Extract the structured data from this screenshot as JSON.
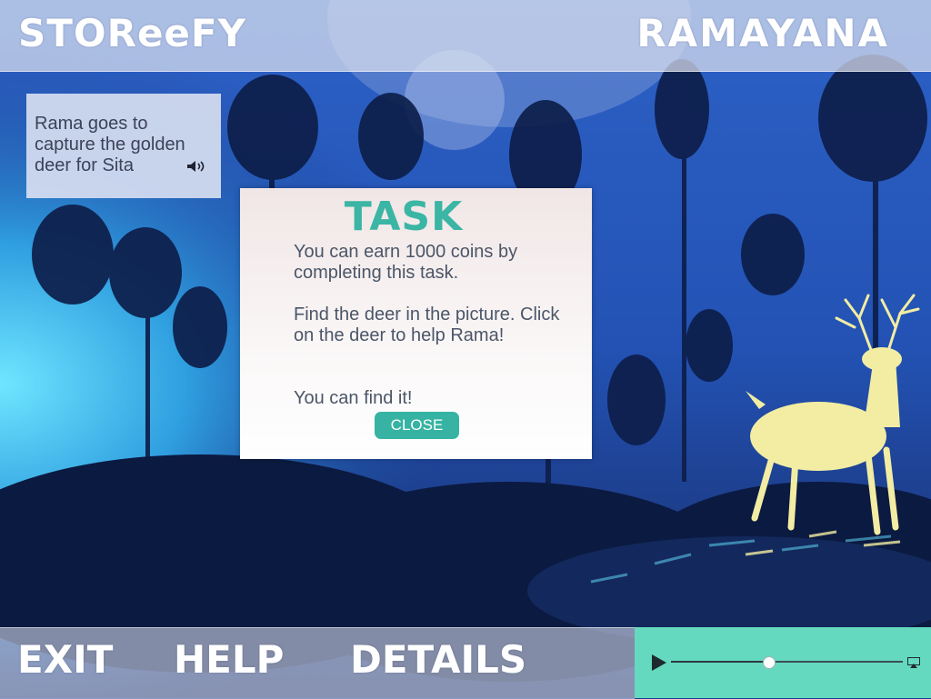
{
  "app": {
    "name": "STOReeFY"
  },
  "story": {
    "title": "RAMAYANA"
  },
  "caption": {
    "text": "Rama goes to capture the golden deer for Sita",
    "audio_icon": "speaker-icon"
  },
  "task_dialog": {
    "title": "TASK",
    "paragraphs": [
      "You can earn 1000 coins by completing this task.",
      "Find the deer in the picture. Click on the deer to help Rama!",
      "You can find it!"
    ],
    "close_label": "CLOSE"
  },
  "bottom_nav": {
    "exit": "EXIT",
    "help": "HELP",
    "details": "DETAILS"
  },
  "player": {
    "play_icon": "play-icon",
    "progress": 0.42,
    "airplay_icon": "airplay-icon"
  },
  "colors": {
    "accent": "#36b3a3",
    "title_accent": "#3bb5a4",
    "player_bg": "#64d9bf",
    "scene_blue": "#1a3a8c",
    "deer": "#f2eda3"
  }
}
